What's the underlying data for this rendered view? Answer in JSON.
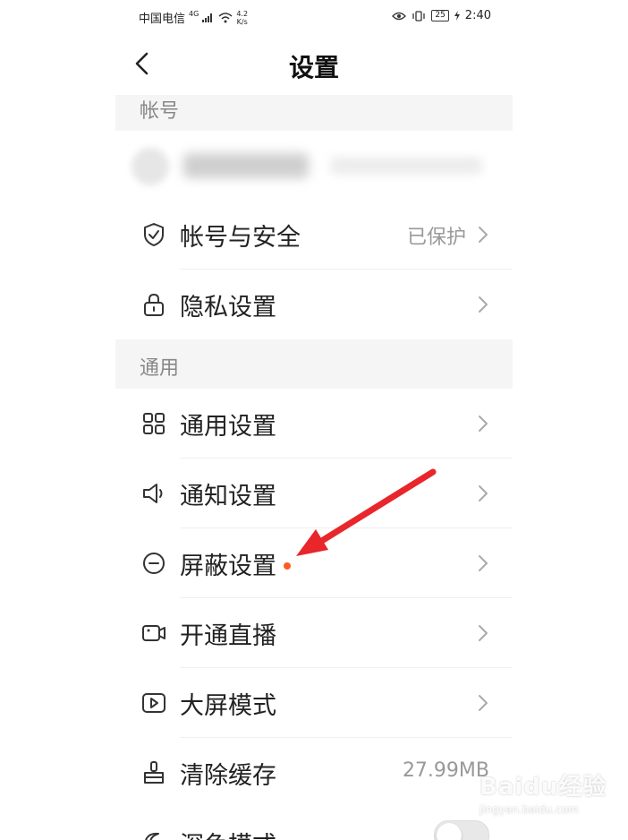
{
  "status_bar": {
    "carrier": "中国电信",
    "network": "4G",
    "speed_value": "4.2",
    "speed_unit": "K/s",
    "battery": "25",
    "time": "2:40"
  },
  "header": {
    "title": "设置"
  },
  "sections": {
    "account_title": "帐号",
    "general_title": "通用"
  },
  "rows": {
    "account_security": {
      "label": "帐号与安全",
      "value": "已保护",
      "icon": "shield-icon"
    },
    "privacy": {
      "label": "隐私设置",
      "icon": "lock-icon"
    },
    "general_settings": {
      "label": "通用设置",
      "icon": "grid-icon"
    },
    "notification": {
      "label": "通知设置",
      "icon": "speaker-icon"
    },
    "block": {
      "label": "屏蔽设置",
      "icon": "minus-circle-icon"
    },
    "live": {
      "label": "开通直播",
      "icon": "video-camera-icon"
    },
    "bigscreen": {
      "label": "大屏模式",
      "icon": "play-screen-icon"
    },
    "clear_cache": {
      "label": "清除缓存",
      "value": "27.99MB",
      "icon": "broom-icon"
    },
    "dark_mode": {
      "label": "深色模式",
      "icon": "moon-icon",
      "toggle_on": false
    }
  },
  "colors": {
    "accent_dot": "#ff5a1f",
    "annotation_arrow": "#e8262b",
    "section_bg": "#f5f5f5"
  },
  "watermark": {
    "logo": "Baidu经验",
    "url": "jingyan.baidu.com"
  }
}
